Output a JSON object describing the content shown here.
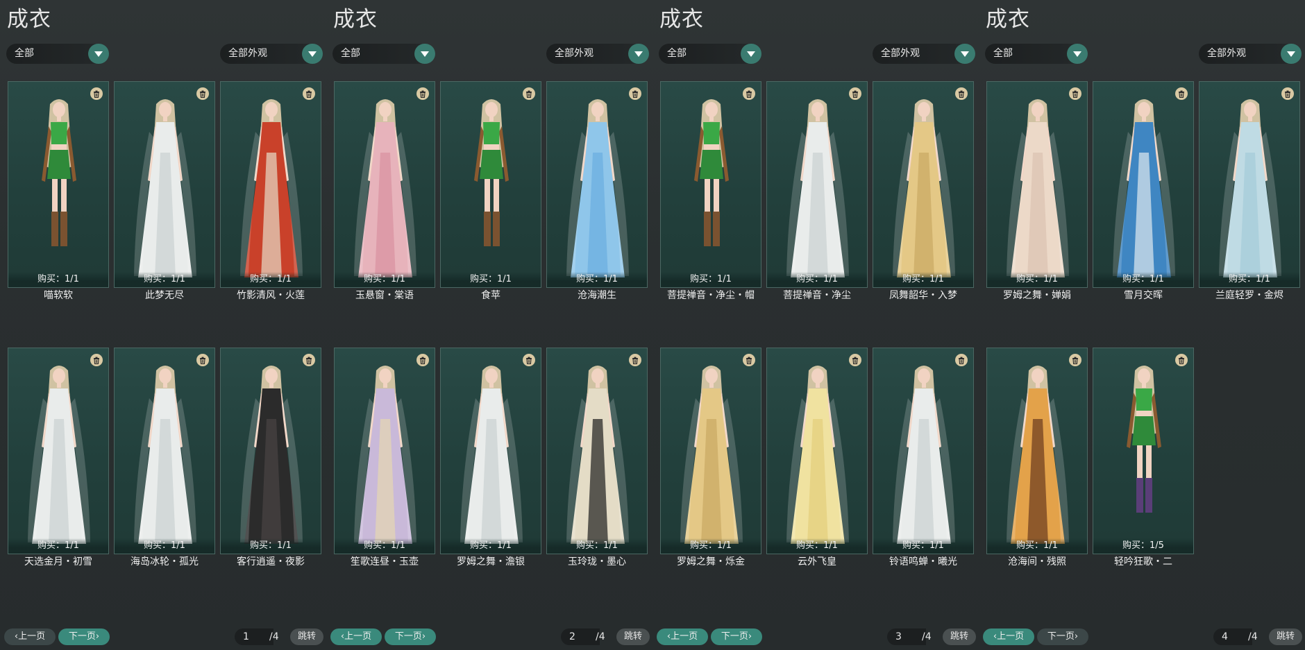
{
  "panels": [
    {
      "title": "成衣",
      "filter_left": "全部",
      "filter_right": "全部外观",
      "items": [
        {
          "name": "喵软软",
          "buy": "购买：1/1",
          "outfit": "green"
        },
        {
          "name": "此梦无尽",
          "buy": "购买：1/1",
          "outfit": "white"
        },
        {
          "name": "竹影清风・火莲",
          "buy": "购买：1/1",
          "outfit": "red"
        },
        {
          "name": "天选金月・初雪",
          "buy": "购买：1/1",
          "outfit": "white"
        },
        {
          "name": "海岛冰轮・孤光",
          "buy": "购买：1/1",
          "outfit": "white"
        },
        {
          "name": "客行逍遥・夜影",
          "buy": "购买：1/1",
          "outfit": "black"
        }
      ],
      "pager": {
        "prev": "上一页",
        "next": "下一页",
        "page": "1",
        "total": "/4",
        "jump": "跳转",
        "active": "next"
      }
    },
    {
      "title": "成衣",
      "filter_left": "全部",
      "filter_right": "全部外观",
      "items": [
        {
          "name": "玉悬窗・棠语",
          "buy": "购买：1/1",
          "outfit": "pink"
        },
        {
          "name": "食苹",
          "buy": "购买：1/1",
          "outfit": "green"
        },
        {
          "name": "沧海潮生",
          "buy": "购买：1/1",
          "outfit": "blue"
        },
        {
          "name": "笙歌连昼・玉壶",
          "buy": "购买：1/1",
          "outfit": "lavender"
        },
        {
          "name": "罗姆之舞・澹银",
          "buy": "购买：1/1",
          "outfit": "white"
        },
        {
          "name": "玉玲珑・墨心",
          "buy": "购买：1/1",
          "outfit": "blackcream"
        }
      ],
      "pager": {
        "prev": "上一页",
        "next": "下一页",
        "page": "2",
        "total": "/4",
        "jump": "跳转",
        "active": "both"
      }
    },
    {
      "title": "成衣",
      "filter_left": "全部",
      "filter_right": "全部外观",
      "items": [
        {
          "name": "菩提禅音・净尘・帽",
          "buy": "购买：1/1",
          "outfit": "green"
        },
        {
          "name": "菩提禅音・净尘",
          "buy": "购买：1/1",
          "outfit": "white"
        },
        {
          "name": "凤舞韶华・入梦",
          "buy": "购买：1/1",
          "outfit": "gold"
        },
        {
          "name": "罗姆之舞・烁金",
          "buy": "购买：1/1",
          "outfit": "gold"
        },
        {
          "name": "云外飞皇",
          "buy": "购买：1/1",
          "outfit": "yellow"
        },
        {
          "name": "铃语鸣蝉・曦光",
          "buy": "购买：1/1",
          "outfit": "white"
        }
      ],
      "pager": {
        "prev": "上一页",
        "next": "下一页",
        "page": "3",
        "total": "/4",
        "jump": "跳转",
        "active": "both"
      }
    },
    {
      "title": "成衣",
      "filter_left": "全部",
      "filter_right": "全部外观",
      "items": [
        {
          "name": "罗姆之舞・婵娟",
          "buy": "购买：1/1",
          "outfit": "cream"
        },
        {
          "name": "雪月交晖",
          "buy": "购买：1/1",
          "outfit": "deepblue"
        },
        {
          "name": "兰庭轻罗・金烬",
          "buy": "购买：1/1",
          "outfit": "lightblue"
        },
        {
          "name": "沧海间・残照",
          "buy": "购买：1/1",
          "outfit": "orange"
        },
        {
          "name": "轻吟狂歌・二",
          "buy": "购买：1/5",
          "outfit": "greenpurple"
        }
      ],
      "pager": {
        "prev": "上一页",
        "next": "下一页",
        "page": "4",
        "total": "/4",
        "jump": "跳转",
        "active": "prev"
      }
    }
  ],
  "colors": {
    "accent": "#3a8a7c",
    "card_bg": "#22403c",
    "background": "#2a2f30"
  },
  "icons": {
    "delete": "trash-icon",
    "dropdown": "chevron-down-icon"
  }
}
